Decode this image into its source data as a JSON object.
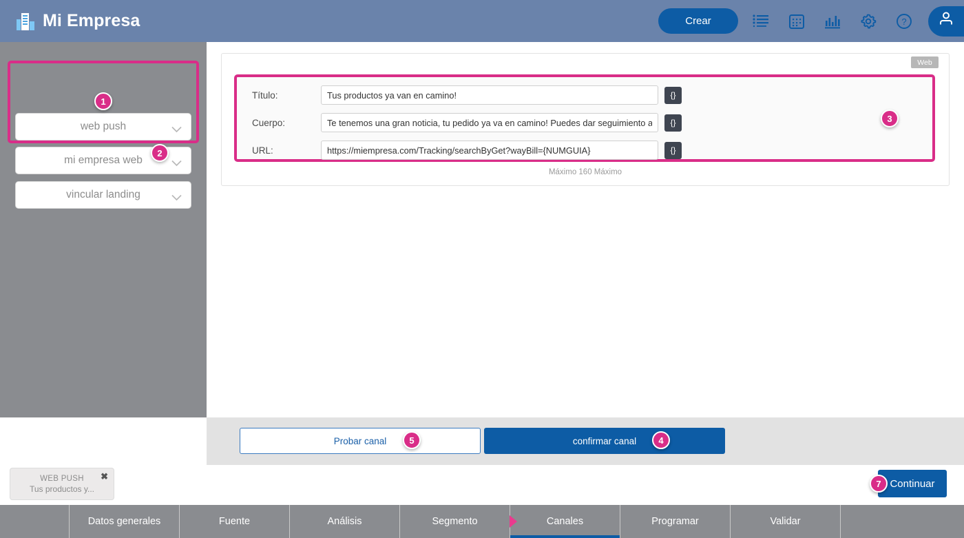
{
  "header": {
    "brand": "Mi Empresa",
    "brand_icon": "building-icon",
    "crear_label": "Crear",
    "icons": [
      {
        "name": "list-icon"
      },
      {
        "name": "calendar-icon"
      },
      {
        "name": "bar-chart-icon"
      },
      {
        "name": "gear-icon"
      },
      {
        "name": "help-icon"
      }
    ],
    "profile_icon": "user-icon",
    "bg_color": "#6a83ab",
    "accent_color": "#0d5ca5"
  },
  "sidebar": {
    "dropdowns": [
      {
        "value": "web push"
      },
      {
        "value": "mi empresa web"
      },
      {
        "value": "vincular landing"
      }
    ],
    "bg_color": "#8a8c90"
  },
  "main": {
    "tab_badge": "Web",
    "fields": [
      {
        "label": "Título:",
        "value": "Tus productos ya van en camino!",
        "token_button": "{}"
      },
      {
        "label": "Cuerpo:",
        "value": "Te tenemos una gran noticia, tu pedido ya va en camino! Puedes dar seguimiento a",
        "token_button": "{}"
      },
      {
        "label": "URL:",
        "value": "https://miempresa.com/Tracking/searchByGet?wayBill={NUMGUIA}",
        "token_button": "{}"
      }
    ],
    "max_note": "Máximo 160 Máximo"
  },
  "actions": {
    "test_label": "Probar canal",
    "confirm_label": "confirmar canal",
    "continue_label": "Continuar"
  },
  "chip": {
    "title": "WEB PUSH",
    "subtitle": "Tus productos y...",
    "close_icon": "close-icon"
  },
  "badges": [
    {
      "number": "1"
    },
    {
      "number": "2"
    },
    {
      "number": "3"
    },
    {
      "number": "4"
    },
    {
      "number": "5"
    },
    {
      "number": "7"
    }
  ],
  "badge_color": "#d92d88",
  "tabs": [
    {
      "label": "Datos generales",
      "active": false
    },
    {
      "label": "Fuente",
      "active": false
    },
    {
      "label": "Análisis",
      "active": false
    },
    {
      "label": "Segmento",
      "active": false
    },
    {
      "label": "Canales",
      "active": true
    },
    {
      "label": "Programar",
      "active": false
    },
    {
      "label": "Validar",
      "active": false
    }
  ]
}
